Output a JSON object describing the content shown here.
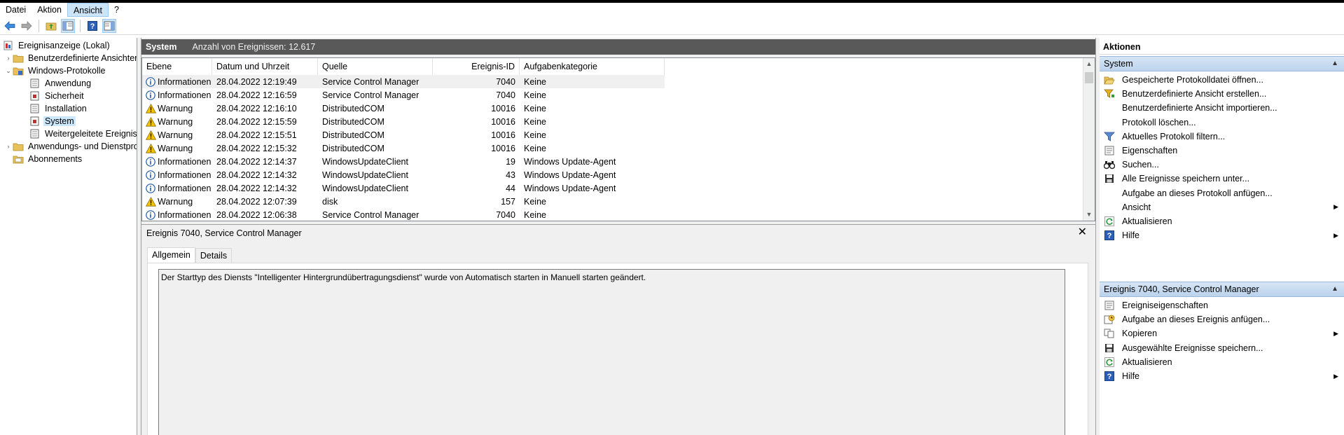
{
  "menubar": {
    "items": [
      {
        "label": "Datei"
      },
      {
        "label": "Aktion"
      },
      {
        "label": "Ansicht"
      },
      {
        "label": "?"
      }
    ]
  },
  "toolbar": {
    "icons": [
      "back-arrow-icon",
      "forward-arrow-icon",
      "folder-up-icon",
      "show-hide-tree-icon",
      "help-icon",
      "show-hide-action-pane-icon"
    ]
  },
  "tree": {
    "items": [
      {
        "label": "Ereignisanzeige (Lokal)",
        "icon": "event-viewer-icon",
        "level": 0,
        "twisty": ""
      },
      {
        "label": "Benutzerdefinierte Ansichten",
        "icon": "folder-icon",
        "level": 1,
        "twisty": "›"
      },
      {
        "label": "Windows-Protokolle",
        "icon": "windows-logs-icon",
        "level": 1,
        "twisty": "⌄"
      },
      {
        "label": "Anwendung",
        "icon": "log-icon",
        "level": 2,
        "twisty": ""
      },
      {
        "label": "Sicherheit",
        "icon": "log-icon",
        "level": 2,
        "twisty": ""
      },
      {
        "label": "Installation",
        "icon": "log-icon",
        "level": 2,
        "twisty": ""
      },
      {
        "label": "System",
        "icon": "log-icon",
        "level": 2,
        "twisty": "",
        "selected": true
      },
      {
        "label": "Weitergeleitete Ereignisse",
        "icon": "log-icon",
        "level": 2,
        "twisty": ""
      },
      {
        "label": "Anwendungs- und Dienstprotokolle",
        "icon": "folder-icon",
        "level": 1,
        "twisty": "›"
      },
      {
        "label": "Abonnements",
        "icon": "subscriptions-icon",
        "level": 1,
        "twisty": ""
      }
    ]
  },
  "center": {
    "title": "System",
    "count": "Anzahl von Ereignissen: 12.617"
  },
  "event_list": {
    "columns": [
      "Ebene",
      "Datum und Uhrzeit",
      "Quelle",
      "Ereignis-ID",
      "Aufgabenkategorie"
    ],
    "rows": [
      {
        "level": "Informationen",
        "icon": "info",
        "date": "28.04.2022 12:19:49",
        "source": "Service Control Manager",
        "id": "7040",
        "category": "Keine"
      },
      {
        "level": "Informationen",
        "icon": "info",
        "date": "28.04.2022 12:16:59",
        "source": "Service Control Manager",
        "id": "7040",
        "category": "Keine"
      },
      {
        "level": "Warnung",
        "icon": "warning",
        "date": "28.04.2022 12:16:10",
        "source": "DistributedCOM",
        "id": "10016",
        "category": "Keine"
      },
      {
        "level": "Warnung",
        "icon": "warning",
        "date": "28.04.2022 12:15:59",
        "source": "DistributedCOM",
        "id": "10016",
        "category": "Keine"
      },
      {
        "level": "Warnung",
        "icon": "warning",
        "date": "28.04.2022 12:15:51",
        "source": "DistributedCOM",
        "id": "10016",
        "category": "Keine"
      },
      {
        "level": "Warnung",
        "icon": "warning",
        "date": "28.04.2022 12:15:32",
        "source": "DistributedCOM",
        "id": "10016",
        "category": "Keine"
      },
      {
        "level": "Informationen",
        "icon": "info",
        "date": "28.04.2022 12:14:37",
        "source": "WindowsUpdateClient",
        "id": "19",
        "category": "Windows Update-Agent"
      },
      {
        "level": "Informationen",
        "icon": "info",
        "date": "28.04.2022 12:14:32",
        "source": "WindowsUpdateClient",
        "id": "43",
        "category": "Windows Update-Agent"
      },
      {
        "level": "Informationen",
        "icon": "info",
        "date": "28.04.2022 12:14:32",
        "source": "WindowsUpdateClient",
        "id": "44",
        "category": "Windows Update-Agent"
      },
      {
        "level": "Warnung",
        "icon": "warning",
        "date": "28.04.2022 12:07:39",
        "source": "disk",
        "id": "157",
        "category": "Keine"
      },
      {
        "level": "Informationen",
        "icon": "info",
        "date": "28.04.2022 12:06:38",
        "source": "Service Control Manager",
        "id": "7040",
        "category": "Keine"
      }
    ]
  },
  "detail": {
    "title": "Ereignis 7040, Service Control Manager",
    "close": "✕",
    "tabs": [
      "Allgemein",
      "Details"
    ],
    "description": "Der Starttyp des Diensts \"Intelligenter Hintergrundübertragungsdienst\" wurde von Automatisch starten in Manuell starten geändert."
  },
  "actions": {
    "title": "Aktionen",
    "group1": {
      "title": "System",
      "items": [
        {
          "label": "Gespeicherte Protokolldatei öffnen...",
          "icon": "open-folder-icon"
        },
        {
          "label": "Benutzerdefinierte Ansicht erstellen...",
          "icon": "filter-create-icon"
        },
        {
          "label": "Benutzerdefinierte Ansicht importieren...",
          "icon": ""
        },
        {
          "label": "Protokoll löschen...",
          "icon": ""
        },
        {
          "label": "Aktuelles Protokoll filtern...",
          "icon": "filter-icon"
        },
        {
          "label": "Eigenschaften",
          "icon": "properties-icon"
        },
        {
          "label": "Suchen...",
          "icon": "binoculars-icon"
        },
        {
          "label": "Alle Ereignisse speichern unter...",
          "icon": "save-icon"
        },
        {
          "label": "Aufgabe an dieses Protokoll anfügen...",
          "icon": ""
        },
        {
          "label": "Ansicht",
          "icon": "",
          "submenu": true
        },
        {
          "label": "Aktualisieren",
          "icon": "refresh-icon"
        },
        {
          "label": "Hilfe",
          "icon": "help-icon",
          "submenu": true
        }
      ]
    },
    "group2": {
      "title": "Ereignis 7040, Service Control Manager",
      "items": [
        {
          "label": "Ereigniseigenschaften",
          "icon": "properties-icon"
        },
        {
          "label": "Aufgabe an dieses Ereignis anfügen...",
          "icon": "task-icon"
        },
        {
          "label": "Kopieren",
          "icon": "copy-icon",
          "submenu": true
        },
        {
          "label": "Ausgewählte Ereignisse speichern...",
          "icon": "save-icon"
        },
        {
          "label": "Aktualisieren",
          "icon": "refresh-icon"
        },
        {
          "label": "Hilfe",
          "icon": "help-icon",
          "submenu": true
        }
      ]
    }
  },
  "colors": {
    "header_bg": "#595959",
    "group_head": "#c8dcf0",
    "selection": "#cce8ff",
    "info_icon": "#1e5aa8",
    "warning_icon": "#f5c400"
  }
}
